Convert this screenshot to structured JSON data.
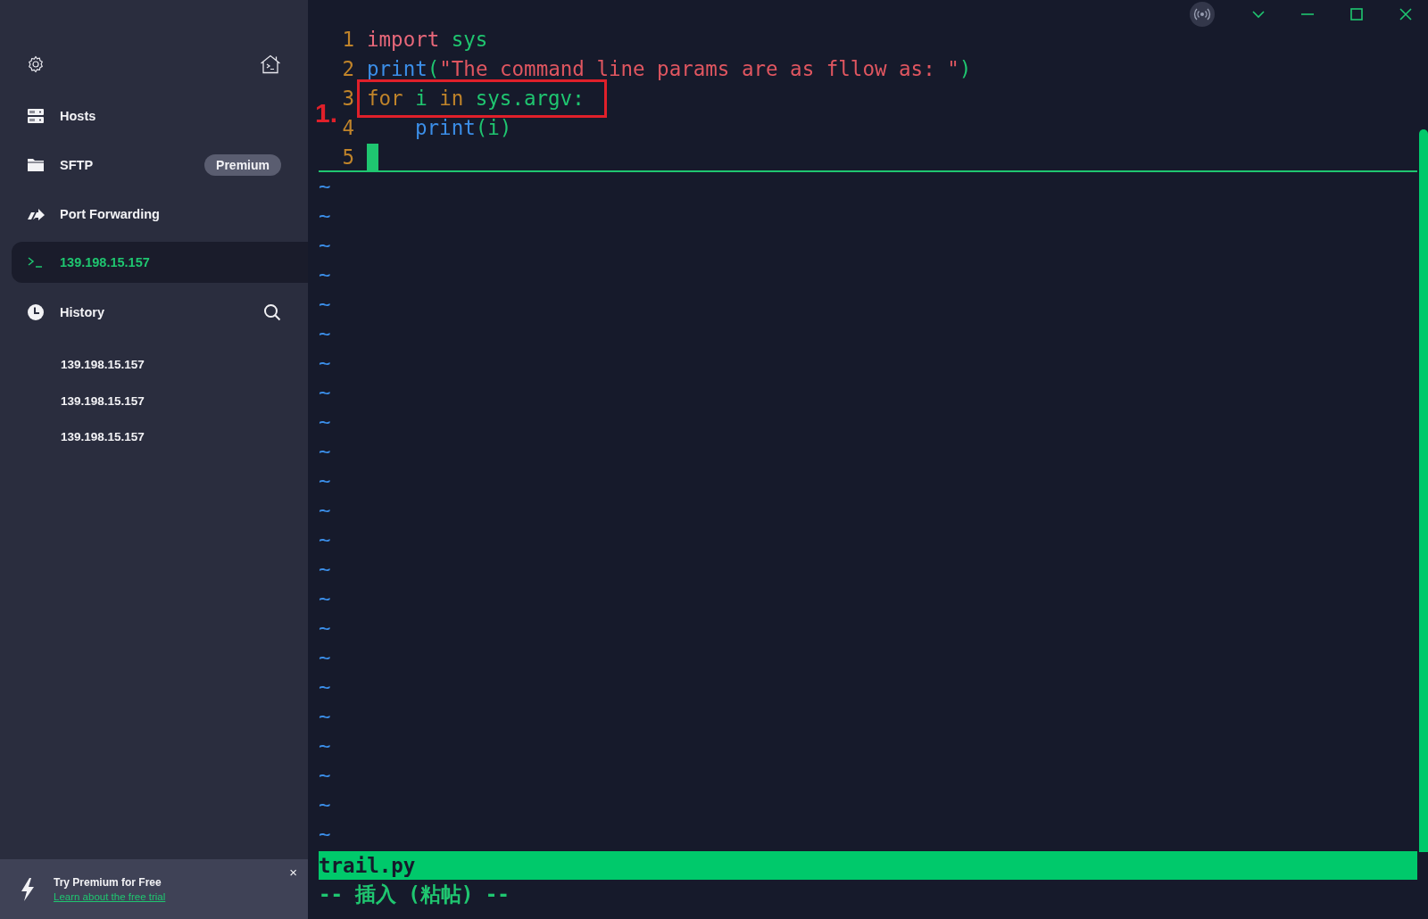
{
  "sidebar": {
    "items": [
      {
        "kind": "hosts",
        "label": "Hosts",
        "selected": false
      },
      {
        "kind": "sftp",
        "label": "SFTP",
        "badge": "Premium",
        "selected": false
      },
      {
        "kind": "port-forwarding",
        "label": "Port Forwarding",
        "selected": false
      },
      {
        "kind": "session",
        "label": "139.198.15.157",
        "selected": true
      }
    ],
    "history": {
      "label": "History",
      "entries": [
        "139.198.15.157",
        "139.198.15.157",
        "139.198.15.157"
      ]
    },
    "promo": {
      "title": "Try Premium for Free",
      "link": "Learn about the free trial",
      "close": "×"
    }
  },
  "editor": {
    "lines": [
      {
        "number": "1",
        "tokens": [
          {
            "kind": "keyword",
            "text": "import"
          },
          {
            "kind": "name",
            "text": "sys",
            "gap": true
          }
        ]
      },
      {
        "number": "2",
        "tokens": [
          {
            "kind": "function",
            "text": "print"
          },
          {
            "kind": "name",
            "text": "("
          },
          {
            "kind": "string",
            "text": "\"The command line params are as fllow as: \""
          },
          {
            "kind": "name",
            "text": ")"
          }
        ]
      },
      {
        "number": "3",
        "highlighted": true,
        "tokens": [
          {
            "kind": "control",
            "text": "for"
          },
          {
            "kind": "name",
            "text": "i",
            "gap": true
          },
          {
            "kind": "control",
            "text": "in",
            "gap": true
          },
          {
            "kind": "name",
            "text": "sys.argv:",
            "gap": true
          }
        ]
      },
      {
        "number": "4",
        "indented": true,
        "tokens": [
          {
            "kind": "function",
            "text": "print"
          },
          {
            "kind": "name",
            "text": "(i)"
          }
        ]
      },
      {
        "number": "5",
        "cursor": true
      }
    ],
    "annotation": "1.",
    "empty_lines": [
      "~",
      "~",
      "~",
      "~",
      "~",
      "~",
      "~",
      "~",
      "~",
      "~",
      "~",
      "~",
      "~",
      "~",
      "~",
      "~",
      "~",
      "~",
      "~",
      "~",
      "~",
      "~",
      "~"
    ],
    "file_name": "trail.py",
    "mode": "-- 插入 (粘帖) --"
  }
}
